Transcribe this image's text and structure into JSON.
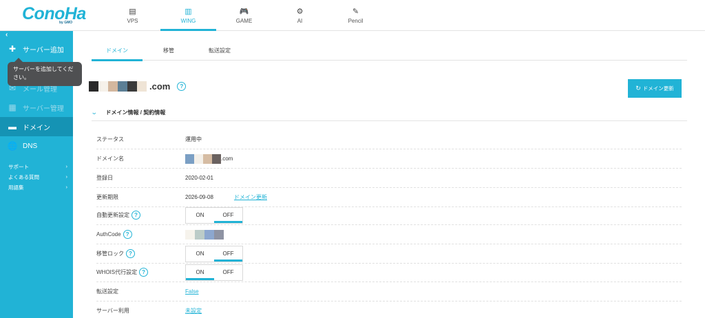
{
  "logo": {
    "text": "ConoHa",
    "sub": "by GMO"
  },
  "topnav": [
    {
      "label": "VPS",
      "icon": "server-icon",
      "glyph": "▤",
      "active": false
    },
    {
      "label": "WING",
      "icon": "wing-icon",
      "glyph": "▥",
      "active": true
    },
    {
      "label": "GAME",
      "icon": "gamepad-icon",
      "glyph": "🎮",
      "active": false
    },
    {
      "label": "AI",
      "icon": "ai-icon",
      "glyph": "⚙",
      "active": false
    },
    {
      "label": "Pencil",
      "icon": "pencil-icon",
      "glyph": "✎",
      "active": false
    }
  ],
  "sidebar": {
    "collapse": "‹",
    "items": [
      {
        "label": "サーバー追加",
        "glyph": "✚"
      },
      {
        "label": "メール管理",
        "glyph": "✉"
      },
      {
        "label": "サーバー管理",
        "glyph": "▦"
      },
      {
        "label": "ドメイン",
        "glyph": "▬"
      },
      {
        "label": "DNS",
        "glyph": "🌐"
      }
    ],
    "links": [
      {
        "label": "サポート",
        "arrow": "›"
      },
      {
        "label": "よくある質問",
        "arrow": "›"
      },
      {
        "label": "用語集",
        "arrow": "›"
      }
    ]
  },
  "tooltip": {
    "text": "サーバーを追加してください。"
  },
  "tabs": [
    "ドメイン",
    "移管",
    "転送設定"
  ],
  "domain": {
    "suffix": ".com",
    "help": "?"
  },
  "renew_button": {
    "label": "ドメイン更新",
    "glyph": "↻"
  },
  "section": {
    "chevron": "⌄",
    "title": "ドメイン情報 / 契約情報"
  },
  "info": {
    "status": {
      "label": "ステータス",
      "value": "運用中"
    },
    "domain_name": {
      "label": "ドメイン名",
      "value": ".com"
    },
    "registered": {
      "label": "登録日",
      "value": "2020-02-01"
    },
    "expires": {
      "label": "更新期限",
      "value": "2026-09-08",
      "link": "ドメイン更新"
    },
    "auto_renew": {
      "label": "自動更新設定",
      "on": "ON",
      "off": "OFF"
    },
    "authcode": {
      "label": "AuthCode"
    },
    "transfer_lock": {
      "label": "移管ロック",
      "on": "ON",
      "off": "OFF"
    },
    "whois": {
      "label": "WHOIS代行設定",
      "on": "ON",
      "off": "OFF"
    },
    "forwarding": {
      "label": "転送設定",
      "value": "False"
    },
    "server_usage": {
      "label": "サーバー利用",
      "value": "未設定"
    }
  },
  "colors": {
    "accent": "#21b3d6",
    "sidebar_active": "#1593b4",
    "tooltip": "#4f5052"
  }
}
